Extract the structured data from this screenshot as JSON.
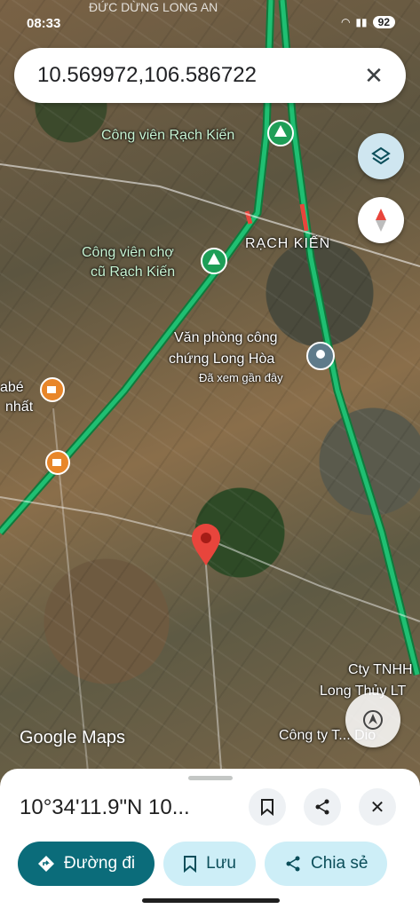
{
  "status": {
    "time": "08:33",
    "battery": "92"
  },
  "top_place_label": "ĐỨC DỪNG LONG AN",
  "search": {
    "query": "10.569972,106.586722"
  },
  "map_labels": {
    "park1": "Công viên Rạch Kiến",
    "rach_kien": "RẠCH KIẾN",
    "park2_line1": "Công viên chợ",
    "park2_line2": "cũ Rạch Kiến",
    "notary_line1": "Văn phòng công",
    "notary_line2": "chứng Long Hòa",
    "notary_sub": "Đã xem gần đây",
    "cafe_line1": "abé",
    "cafe_line2": "nhất",
    "cty_line1": "Cty TNHH",
    "cty_line2": "Long Thủy LT",
    "company": "Công ty T... Dio"
  },
  "brand": "Google Maps",
  "sheet": {
    "coords": "10°34'11.9\"N 10...",
    "directions": "Đường đi",
    "save": "Lưu",
    "share": "Chia sẻ"
  },
  "colors": {
    "traffic_green": "#1fbf72",
    "pin_red": "#e8453c",
    "primary": "#0b6c7a"
  }
}
